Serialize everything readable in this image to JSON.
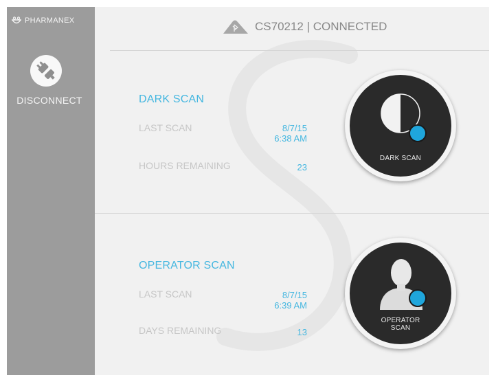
{
  "sidebar": {
    "brand": "PHARMANEX",
    "disconnect_label": "DISCONNECT"
  },
  "header": {
    "status": "CS70212 | CONNECTED"
  },
  "dark_scan": {
    "title": "DARK SCAN",
    "last_scan_label": "LAST SCAN",
    "last_scan_date": "8/7/15",
    "last_scan_time": "6:38 AM",
    "remaining_label": "HOURS REMAINING",
    "remaining_value": "23",
    "button_label": "DARK SCAN"
  },
  "operator_scan": {
    "title": "OPERATOR SCAN",
    "last_scan_label": "LAST SCAN",
    "last_scan_date": "8/7/15",
    "last_scan_time": "6:39 AM",
    "remaining_label": "DAYS REMAINING",
    "remaining_value": "13",
    "button_label_1": "OPERATOR",
    "button_label_2": "SCAN"
  },
  "colors": {
    "accent": "#45b7e0",
    "sidebar": "#9c9c9c",
    "background": "#f1f1f1",
    "button_dark": "#2a2a2a",
    "indicator": "#1fa6dc"
  }
}
